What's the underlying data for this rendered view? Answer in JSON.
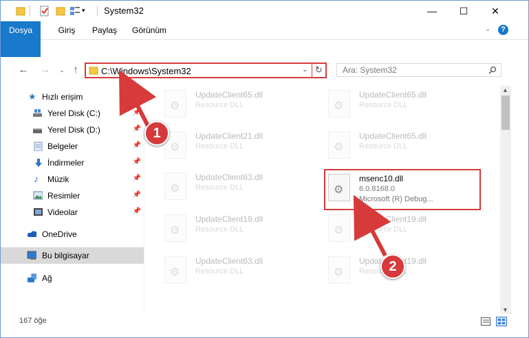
{
  "window": {
    "title": "System32",
    "minimize": "—",
    "maximize": "☐",
    "close": "✕"
  },
  "ribbon": {
    "tabs": [
      "Dosya",
      "Giriş",
      "Paylaş",
      "Görünüm"
    ],
    "help": "?"
  },
  "address": {
    "path": "C:\\Windows\\System32",
    "search_placeholder": "Ara: System32"
  },
  "sidebar": {
    "items": [
      {
        "label": "Hızlı erişim",
        "icon": "star-icon"
      },
      {
        "label": "Yerel Disk (C:)",
        "icon": "drive-icon",
        "pinned": true
      },
      {
        "label": "Yerel Disk (D:)",
        "icon": "drive-icon",
        "pinned": true
      },
      {
        "label": "Belgeler",
        "icon": "documents-icon",
        "pinned": true
      },
      {
        "label": "İndirmeler",
        "icon": "download-icon",
        "pinned": true
      },
      {
        "label": "Müzik",
        "icon": "music-icon",
        "pinned": true
      },
      {
        "label": "Resimler",
        "icon": "pictures-icon",
        "pinned": true
      },
      {
        "label": "Videolar",
        "icon": "videos-icon",
        "pinned": true
      },
      {
        "label": "OneDrive",
        "icon": "cloud-icon"
      },
      {
        "label": "Bu bilgisayar",
        "icon": "computer-icon",
        "selected": true
      },
      {
        "label": "Ağ",
        "icon": "network-icon"
      }
    ]
  },
  "files": [
    {
      "name": "UpdateClient65.dll",
      "type": "Resource DLL"
    },
    {
      "name": "UpdateClient65.dll",
      "type": "Resource DLL"
    },
    {
      "name": "UpdateClient21.dll",
      "type": "Resource DLL"
    },
    {
      "name": "UpdateClient65.dll",
      "type": "Resource DLL"
    },
    {
      "name": "UpdateClient63.dll",
      "type": "Resource DLL"
    },
    {
      "name": "msenc10.dll",
      "version": "6.0.8168.0",
      "type": "Microsoft (R) Debug..."
    },
    {
      "name": "UpdateClient19.dll",
      "type": "Resource DLL"
    },
    {
      "name": "UpdateClient19.dll",
      "type": "Resource DLL"
    },
    {
      "name": "UpdateClient63.dll",
      "type": "Resource DLL"
    },
    {
      "name": "UpdateClient19.dll",
      "type": "Resource DLL"
    }
  ],
  "status": {
    "item_count": "167 öğe"
  },
  "annotations": {
    "step1": "1",
    "step2": "2",
    "color": "#d63a3a"
  }
}
